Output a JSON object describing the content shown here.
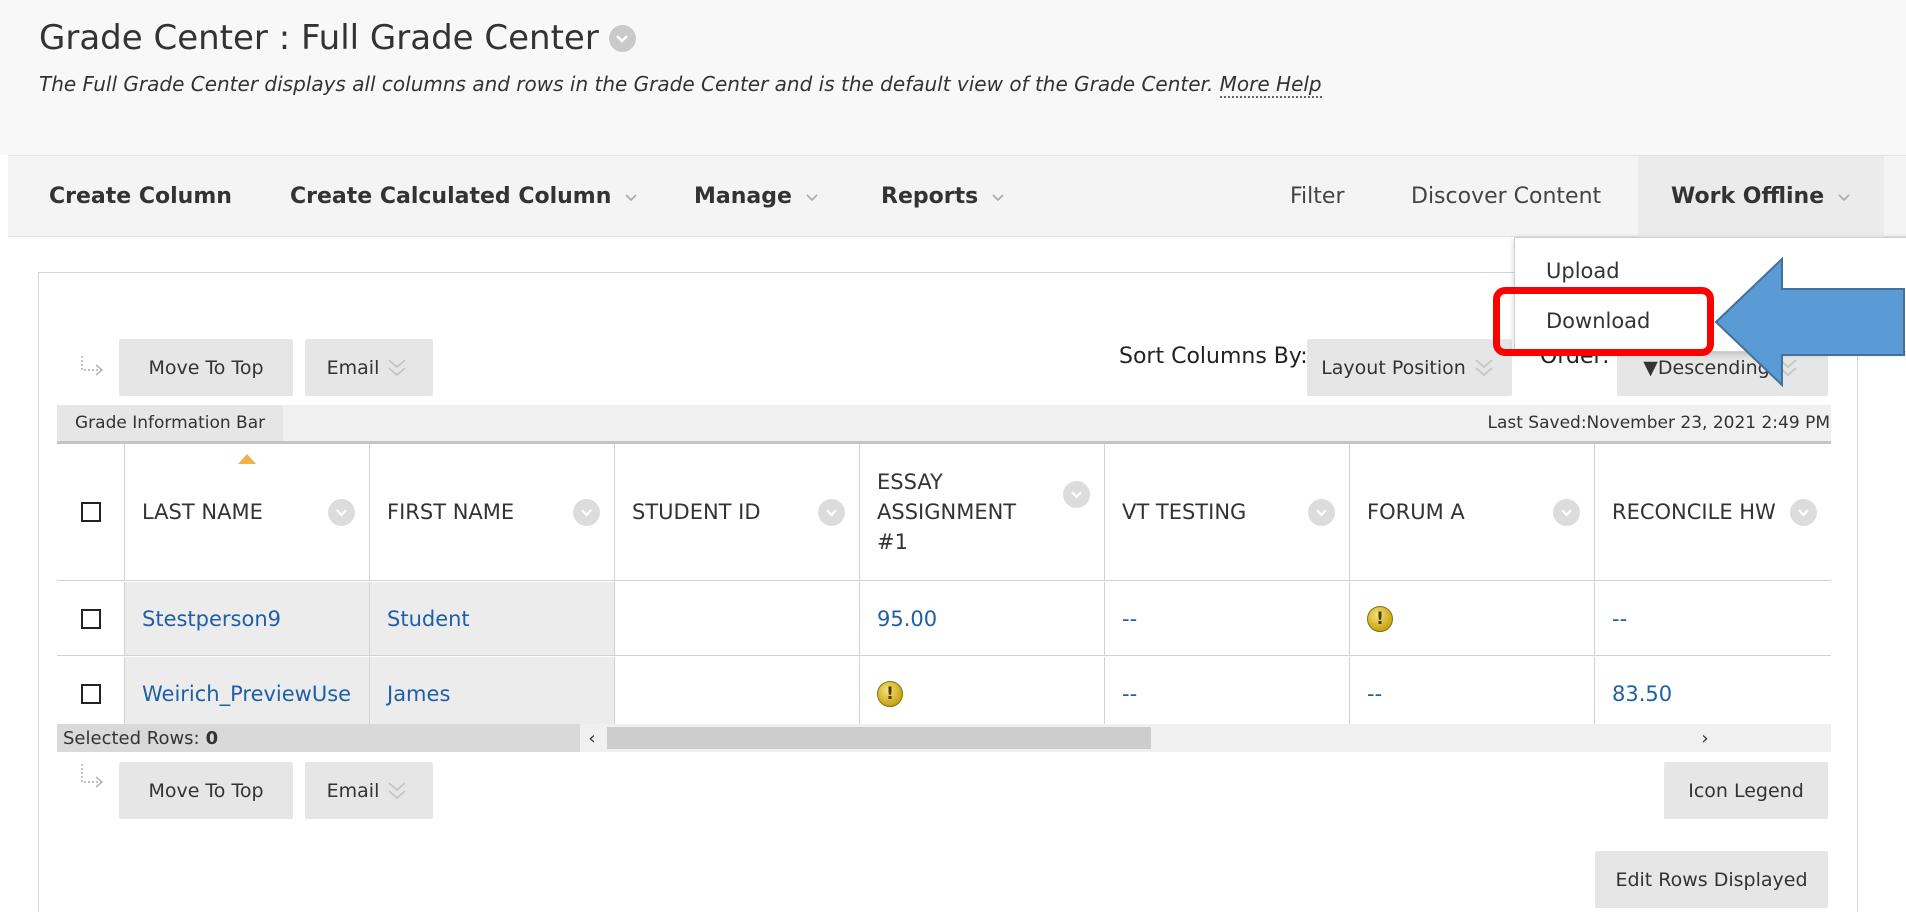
{
  "header": {
    "title": "Grade Center : Full Grade Center",
    "subtitle": "The Full Grade Center displays all columns and rows in the Grade Center and is the default view of the Grade Center.",
    "more_help": "More Help"
  },
  "actionbar": {
    "create_column": "Create Column",
    "create_calculated_column": "Create Calculated Column",
    "manage": "Manage",
    "reports": "Reports",
    "filter": "Filter",
    "discover_content": "Discover Content",
    "work_offline": "Work Offline"
  },
  "work_offline_menu": {
    "upload": "Upload",
    "download": "Download"
  },
  "toolbar_top": {
    "move_to_top": "Move To Top",
    "email": "Email",
    "sort_columns_by_label": "Sort Columns By:",
    "sort_columns_by_value": "Layout Position",
    "order_label": "Order:",
    "order_value": "▼Descending"
  },
  "info_bar": {
    "grade_information_bar": "Grade Information Bar",
    "last_saved": "Last Saved:November 23, 2021 2:49 PM"
  },
  "grid": {
    "columns": [
      "LAST NAME",
      "FIRST NAME",
      "STUDENT ID",
      "ESSAY ASSIGNMENT #1",
      "VT TESTING",
      "FORUM A",
      "RECONCILE HW"
    ],
    "essay_lines": [
      "ESSAY",
      "ASSIGNMENT",
      "#1"
    ],
    "rows": [
      {
        "last_name": "Stestperson9",
        "first_name": "Student",
        "student_id": "",
        "essay": "95.00",
        "vt_testing": "--",
        "forum_a": "needs-grading",
        "reconcile_hw": "--"
      },
      {
        "last_name": "Weirich_PreviewUse",
        "first_name": "James",
        "student_id": "",
        "essay": "needs-grading",
        "vt_testing": "--",
        "forum_a": "--",
        "reconcile_hw": "83.50"
      }
    ]
  },
  "footer": {
    "selected_rows_label": "Selected Rows:",
    "selected_rows_count": "0",
    "move_to_top": "Move To Top",
    "email": "Email",
    "icon_legend": "Icon Legend",
    "edit_rows_displayed": "Edit Rows Displayed"
  },
  "colors": {
    "link": "#1f5fa8",
    "highlight": "#ff0000",
    "callout_arrow": "#5b9bd5"
  }
}
